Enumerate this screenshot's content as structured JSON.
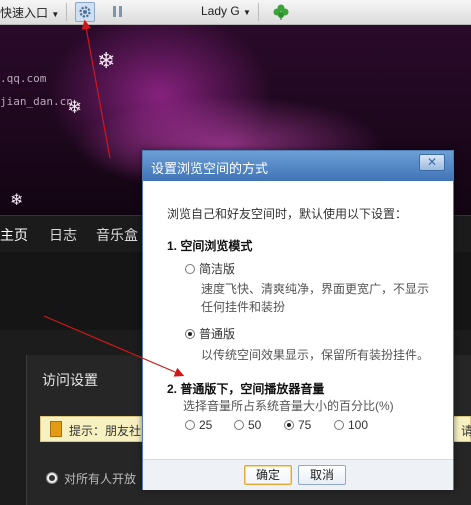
{
  "toolbar": {
    "quick_entry": "快速入口",
    "user": "Lady G",
    "icons": [
      "settings-gear-icon",
      "pause-icon",
      "clover-icon"
    ]
  },
  "banner": {
    "domain": ".qq.com",
    "user_url": "jian_dan.cn"
  },
  "nav": {
    "tabs": [
      "主页",
      "日志",
      "音乐盒"
    ]
  },
  "page": {
    "section_title": "访问设置",
    "tip_prefix": "提示：",
    "tip_text": "朋友社",
    "tip_tail": "请",
    "open_to_all": "对所有人开放"
  },
  "dialog": {
    "title": "设置浏览空间的方式",
    "close": "✕",
    "intro": "浏览自己和好友空间时，默认使用以下设置：",
    "section1": "1. 空间浏览模式",
    "option_clean": "简洁版",
    "clean_desc_line1": "速度飞快、清爽纯净，界面更宽广，不显示",
    "clean_desc_line2": "任何挂件和装扮",
    "option_normal": "普通版",
    "normal_desc": "以传统空间效果显示，保留所有装扮挂件。",
    "selected_mode": "普通版",
    "section2": "2. 普通版下，空间播放器音量",
    "volume_desc": "选择音量所占系统音量大小的百分比(%)",
    "volume_options": [
      "25",
      "50",
      "75",
      "100"
    ],
    "volume_selected": "75",
    "ok": "确定",
    "cancel": "取消"
  },
  "colors": {
    "dialog_header": "#4f84c2",
    "annotation_arrow": "#d01818",
    "tip_background": "#f7f1c2"
  }
}
